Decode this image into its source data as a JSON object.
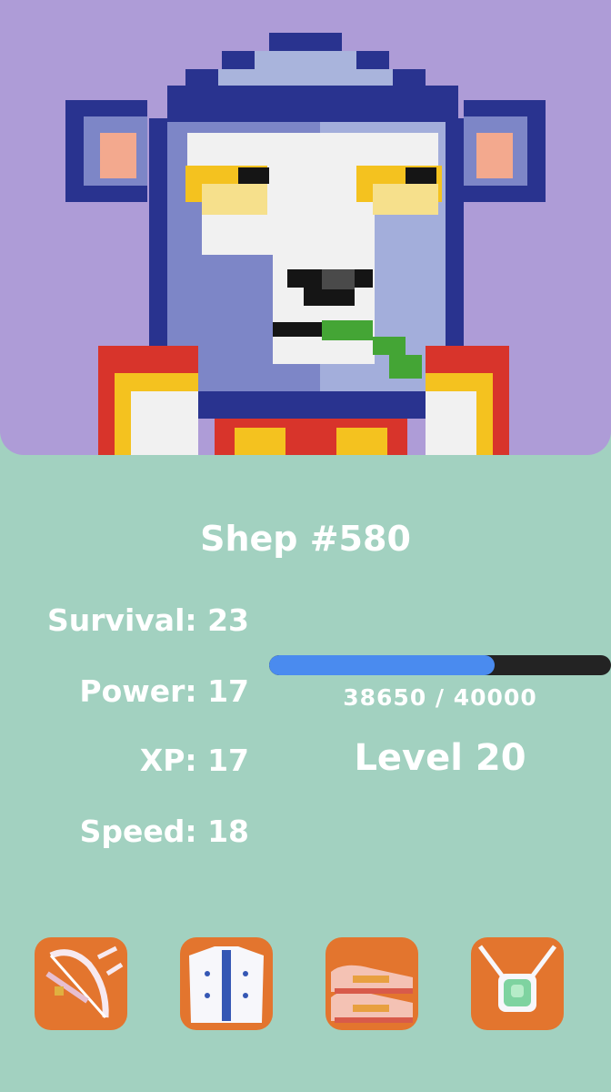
{
  "character": {
    "name": "Shep #580"
  },
  "stats": [
    {
      "label": "Survival: 23"
    },
    {
      "label": "Power: 17"
    },
    {
      "label": "XP: 17"
    },
    {
      "label": "Speed: 18"
    }
  ],
  "progress": {
    "text": "38650 / 40000",
    "current": 38650,
    "max": 40000,
    "fill_fraction": 0.66
  },
  "level": {
    "label": "Level 20"
  },
  "items": [
    {
      "icon": "bow-icon"
    },
    {
      "icon": "armor-icon"
    },
    {
      "icon": "shoes-icon"
    },
    {
      "icon": "amulet-icon"
    }
  ],
  "colors": {
    "background": "#a2d1c0",
    "portrait_bg": "#ae9cd7",
    "bar_fill": "#4a8bef",
    "bar_track": "#232323",
    "item_bg": "#e3752e"
  }
}
